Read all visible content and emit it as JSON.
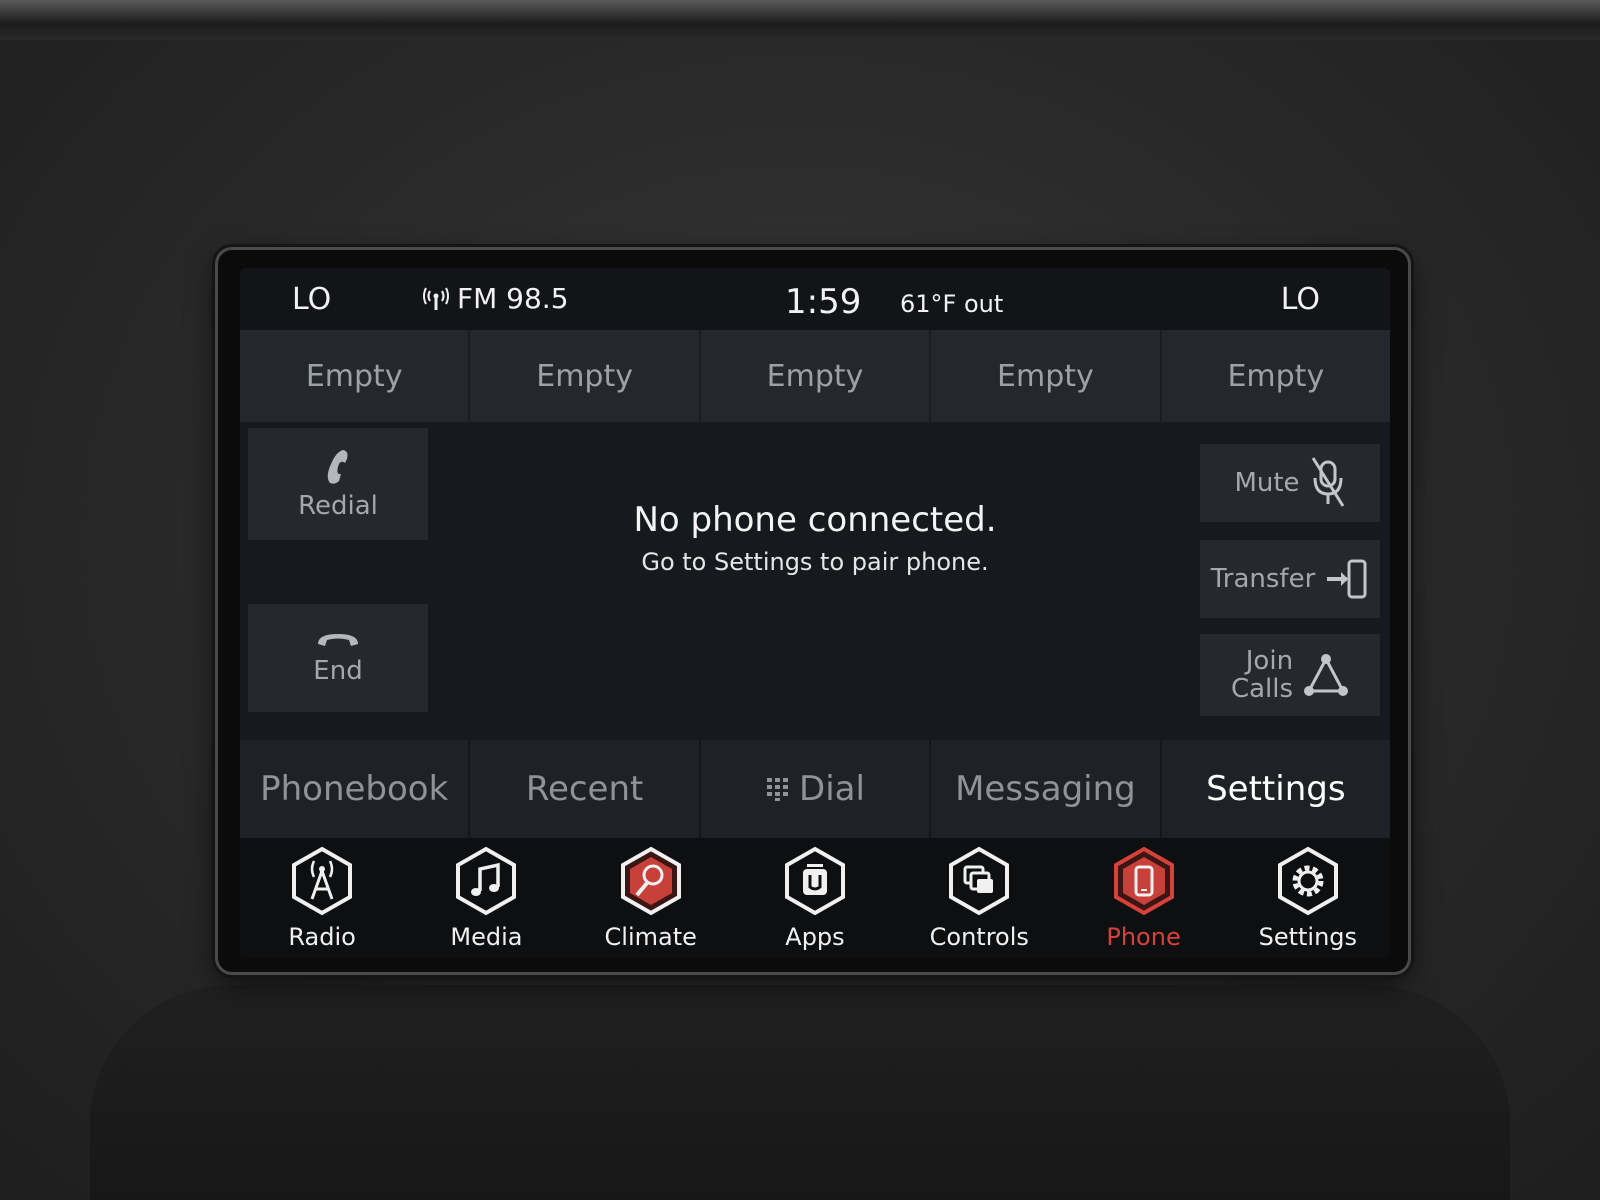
{
  "status": {
    "left_zone": "LO",
    "radio": "FM 98.5",
    "clock": "1:59",
    "temperature": "61°F out",
    "right_zone": "LO"
  },
  "presets": [
    "Empty",
    "Empty",
    "Empty",
    "Empty",
    "Empty"
  ],
  "left_actions": {
    "redial": "Redial",
    "end": "End"
  },
  "right_actions": {
    "mute": "Mute",
    "transfer": "Transfer",
    "join_line1": "Join",
    "join_line2": "Calls"
  },
  "message": {
    "title": "No phone connected.",
    "subtitle": "Go to Settings to pair phone."
  },
  "tabs": {
    "phonebook": "Phonebook",
    "recent": "Recent",
    "dial": "Dial",
    "messaging": "Messaging",
    "settings": "Settings",
    "active": "settings"
  },
  "nav": [
    {
      "label": "Radio",
      "icon": "radio-tower-icon"
    },
    {
      "label": "Media",
      "icon": "music-note-icon"
    },
    {
      "label": "Climate",
      "icon": "climate-icon"
    },
    {
      "label": "Apps",
      "icon": "apps-icon"
    },
    {
      "label": "Controls",
      "icon": "controls-icon"
    },
    {
      "label": "Phone",
      "icon": "phone-icon"
    },
    {
      "label": "Settings",
      "icon": "gear-icon"
    }
  ],
  "active_nav": "Phone",
  "colors": {
    "accent": "#d8403a",
    "active_text": "#ffffff",
    "inactive_text": "#8f9398"
  }
}
